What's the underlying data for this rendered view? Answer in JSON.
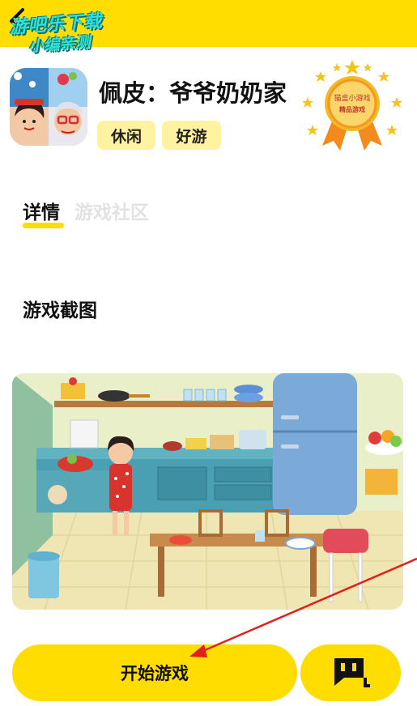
{
  "header": {
    "watermark_line1": "游吧乐下载",
    "watermark_line2": "小编亲测"
  },
  "app": {
    "title": "佩皮：爷爷奶奶家",
    "tags": [
      "休闲",
      "好游"
    ]
  },
  "badge": {
    "line1": "猫盒小游戏",
    "line2": "精品游戏"
  },
  "tabs": {
    "detail": "详情",
    "community": "游戏社区",
    "active": "详情"
  },
  "section": {
    "screenshots_title": "游戏截图"
  },
  "bottom_bar": {
    "start_label": "开始游戏"
  },
  "colors": {
    "accent": "#ffdd00",
    "tag_bg": "#fff2a0",
    "annotation_arrow": "#e0201a"
  },
  "icons": {
    "back": "chevron-left-icon",
    "chat": "chat-bubble-icon",
    "badge": "award-medal-icon"
  }
}
